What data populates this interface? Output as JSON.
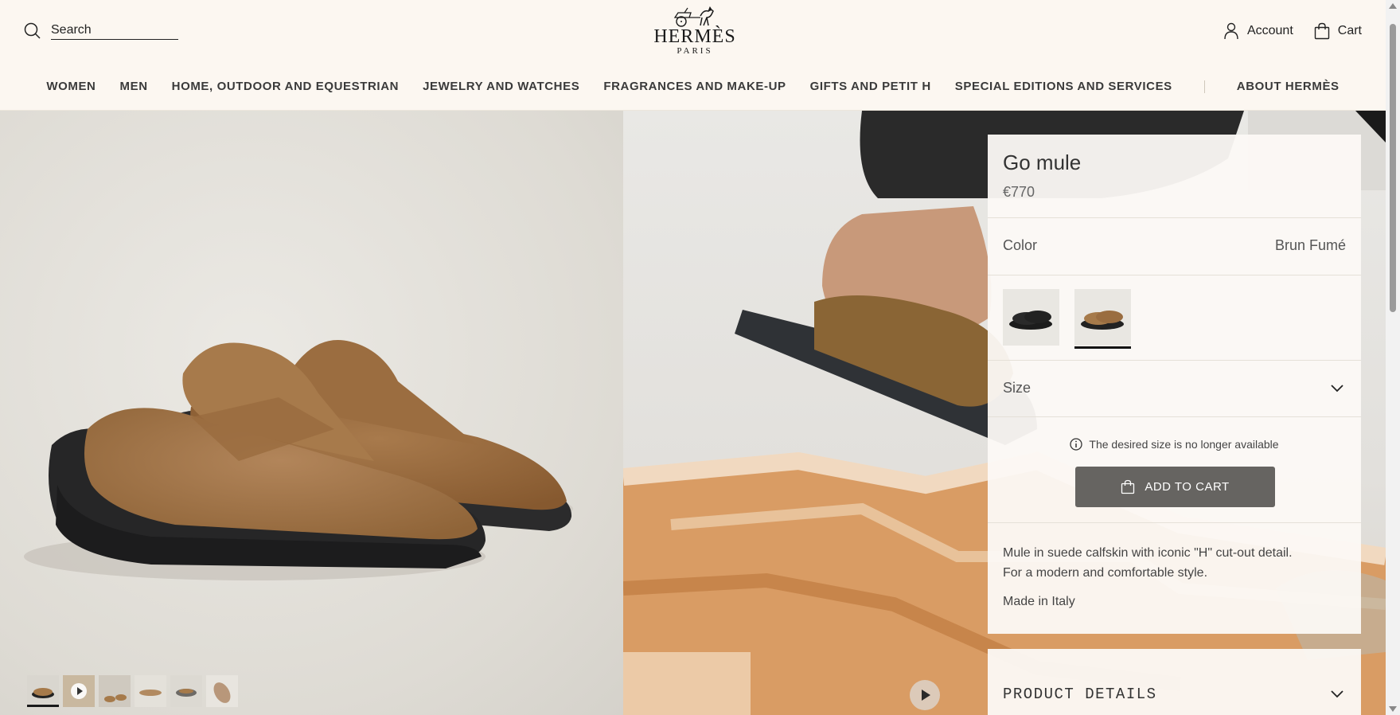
{
  "header": {
    "search_label": "Search",
    "logo_word": "HERMÈS",
    "logo_sub": "PARIS",
    "account_label": "Account",
    "cart_label": "Cart"
  },
  "nav": {
    "items": [
      {
        "label": "WOMEN"
      },
      {
        "label": "MEN"
      },
      {
        "label": "HOME, OUTDOOR AND EQUESTRIAN"
      },
      {
        "label": "JEWELRY AND WATCHES"
      },
      {
        "label": "FRAGRANCES AND MAKE-UP"
      },
      {
        "label": "GIFTS AND PETIT H"
      },
      {
        "label": "SPECIAL EDITIONS AND SERVICES"
      }
    ],
    "about_label": "ABOUT HERMÈS"
  },
  "gallery": {
    "thumbnail_count": 6,
    "active_thumbnail": 1,
    "video_thumbnail": 2
  },
  "product": {
    "title": "Go mule",
    "price": "€770",
    "color_label": "Color",
    "color_value": "Brun Fumé",
    "swatches": [
      {
        "name": "black",
        "color": "#1c1c1c",
        "selected": false
      },
      {
        "name": "brun-fume",
        "color": "#a67a4a",
        "selected": true
      }
    ],
    "size_label": "Size",
    "availability_msg": "The desired size is no longer available",
    "add_to_cart": "ADD TO CART",
    "desc_line1": "Mule in suede calfskin with iconic \"H\" cut-out detail.",
    "desc_line2": "For a modern and comfortable style.",
    "made_in": "Made in Italy",
    "details_label": "PRODUCT DETAILS"
  },
  "colors": {
    "header_bg": "#fcf7f1",
    "button_bg": "#666461",
    "suede": "#a67a4a",
    "sole": "#2a2a2a"
  }
}
